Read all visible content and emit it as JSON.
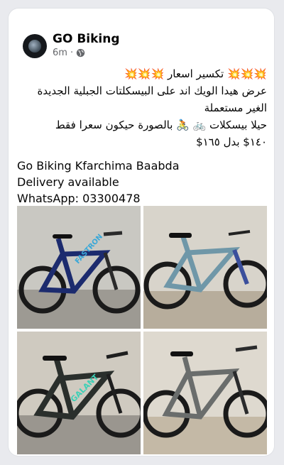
{
  "post": {
    "page_name": "GO Biking",
    "time": "6m",
    "separator": "·",
    "line_ar_1": "💥💥💥 تكسير اسعار 💥💥💥",
    "line_ar_2": "عرض هيدا الويك اند على البيسكلتات الجبلية الجديدة الغير مستعملة",
    "line_ar_3": "حيلا بيسكلات 🚲 🚴 بالصورة حيكون سعرا فقط",
    "line_ar_4": "١٤٠$ بدل ١٦٥$",
    "line_en_1": "Go Biking Kfarchima Baabda",
    "line_en_2": "Delivery available",
    "line_en_3": "WhatsApp: 03300478"
  },
  "photos": [
    {
      "brand": "FASTRON",
      "frame_color": "#1c2b6e",
      "accent": "#39a8d8"
    },
    {
      "brand": "",
      "frame_color": "#6f97a8",
      "accent": "#3b4f9c"
    },
    {
      "brand": "GALANT",
      "frame_color": "#2a2f2c",
      "accent": "#3ed0b6"
    },
    {
      "brand": "",
      "frame_color": "#6a6d6c",
      "accent": "#2a2b2c"
    }
  ],
  "colors": {
    "background": "#e9eaee",
    "card": "#ffffff",
    "text": "#050505",
    "meta": "#65676b"
  },
  "icons": {
    "avatar": "moon-avatar-icon",
    "privacy": "globe-icon"
  }
}
